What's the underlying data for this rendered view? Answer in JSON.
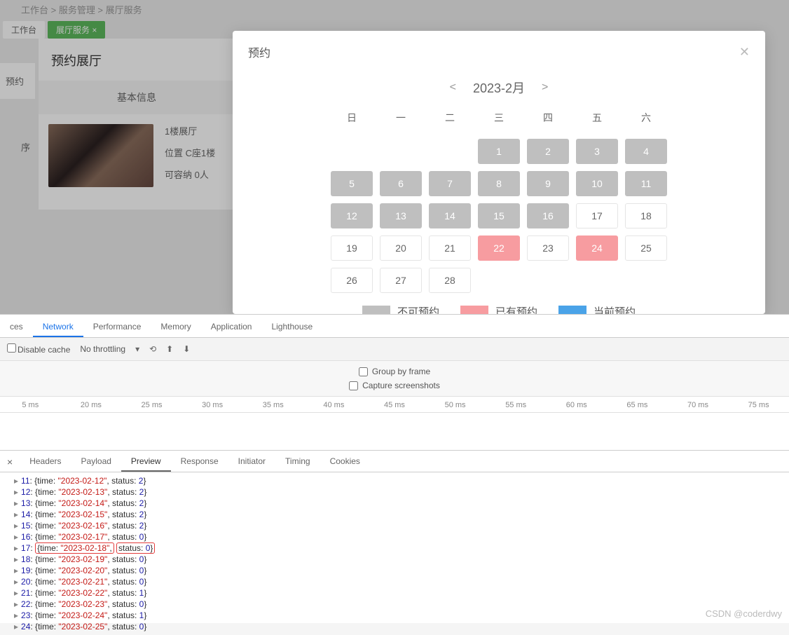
{
  "breadcrumb": "工作台 > 服务管理 > 展厅服务",
  "tabs": [
    {
      "label": "工作台",
      "active": false
    },
    {
      "label": "展厅服务 ×",
      "active": true
    }
  ],
  "sideStrip": {
    "button": "预约"
  },
  "colHead": "序",
  "leftPanel": {
    "title": "预约展厅",
    "sectionHeader": "基本信息",
    "info": {
      "line1": "1楼展厅",
      "line2": "位置 C座1楼",
      "line3": "可容纳 0人"
    }
  },
  "modal": {
    "title": "预约",
    "close": "✕",
    "month": "2023-2月",
    "prev": "<",
    "next": ">",
    "daysOfWeek": [
      "日",
      "一",
      "二",
      "三",
      "四",
      "五",
      "六"
    ],
    "cells": [
      {
        "n": "",
        "s": "empty"
      },
      {
        "n": "",
        "s": "empty"
      },
      {
        "n": "",
        "s": "empty"
      },
      {
        "n": "1",
        "s": "unavail"
      },
      {
        "n": "2",
        "s": "unavail"
      },
      {
        "n": "3",
        "s": "unavail"
      },
      {
        "n": "4",
        "s": "unavail"
      },
      {
        "n": "5",
        "s": "unavail"
      },
      {
        "n": "6",
        "s": "unavail"
      },
      {
        "n": "7",
        "s": "unavail"
      },
      {
        "n": "8",
        "s": "unavail"
      },
      {
        "n": "9",
        "s": "unavail"
      },
      {
        "n": "10",
        "s": "unavail"
      },
      {
        "n": "11",
        "s": "unavail"
      },
      {
        "n": "12",
        "s": "unavail"
      },
      {
        "n": "13",
        "s": "unavail"
      },
      {
        "n": "14",
        "s": "unavail"
      },
      {
        "n": "15",
        "s": "unavail"
      },
      {
        "n": "16",
        "s": "unavail"
      },
      {
        "n": "17",
        "s": "avail"
      },
      {
        "n": "18",
        "s": "avail"
      },
      {
        "n": "19",
        "s": "avail"
      },
      {
        "n": "20",
        "s": "avail"
      },
      {
        "n": "21",
        "s": "avail"
      },
      {
        "n": "22",
        "s": "booked"
      },
      {
        "n": "23",
        "s": "avail"
      },
      {
        "n": "24",
        "s": "booked"
      },
      {
        "n": "25",
        "s": "avail"
      },
      {
        "n": "26",
        "s": "avail"
      },
      {
        "n": "27",
        "s": "avail"
      },
      {
        "n": "28",
        "s": "avail"
      }
    ],
    "legend": {
      "unavail": "不可预约",
      "booked": "已有预约",
      "current": "当前预约"
    }
  },
  "devtools": {
    "tabs": [
      "ces",
      "Network",
      "Performance",
      "Memory",
      "Application",
      "Lighthouse"
    ],
    "activeTab": "Network",
    "toolbar": {
      "disableCache": "Disable cache",
      "throttling": "No throttling"
    },
    "opts": {
      "groupByFrame": "Group by frame",
      "captureScreens": "Capture screenshots"
    },
    "ticks": [
      "5 ms",
      "20 ms",
      "25 ms",
      "30 ms",
      "35 ms",
      "40 ms",
      "45 ms",
      "50 ms",
      "55 ms",
      "60 ms",
      "65 ms",
      "70 ms",
      "75 ms"
    ],
    "subtabs": [
      "Headers",
      "Payload",
      "Preview",
      "Response",
      "Initiator",
      "Timing",
      "Cookies"
    ],
    "activeSubtab": "Preview",
    "jsonLines": [
      {
        "idx": "11",
        "time": "2023-02-12",
        "status": "2",
        "hl": false
      },
      {
        "idx": "12",
        "time": "2023-02-13",
        "status": "2",
        "hl": false
      },
      {
        "idx": "13",
        "time": "2023-02-14",
        "status": "2",
        "hl": false
      },
      {
        "idx": "14",
        "time": "2023-02-15",
        "status": "2",
        "hl": false
      },
      {
        "idx": "15",
        "time": "2023-02-16",
        "status": "2",
        "hl": false
      },
      {
        "idx": "16",
        "time": "2023-02-17",
        "status": "0",
        "hl": false
      },
      {
        "idx": "17",
        "time": "2023-02-18",
        "status": "0",
        "hl": true
      },
      {
        "idx": "18",
        "time": "2023-02-19",
        "status": "0",
        "hl": false
      },
      {
        "idx": "19",
        "time": "2023-02-20",
        "status": "0",
        "hl": false
      },
      {
        "idx": "20",
        "time": "2023-02-21",
        "status": "0",
        "hl": false
      },
      {
        "idx": "21",
        "time": "2023-02-22",
        "status": "1",
        "hl": false
      },
      {
        "idx": "22",
        "time": "2023-02-23",
        "status": "0",
        "hl": false
      },
      {
        "idx": "23",
        "time": "2023-02-24",
        "status": "1",
        "hl": false
      },
      {
        "idx": "24",
        "time": "2023-02-25",
        "status": "0",
        "hl": false
      }
    ]
  },
  "watermark": "CSDN @coderdwy"
}
